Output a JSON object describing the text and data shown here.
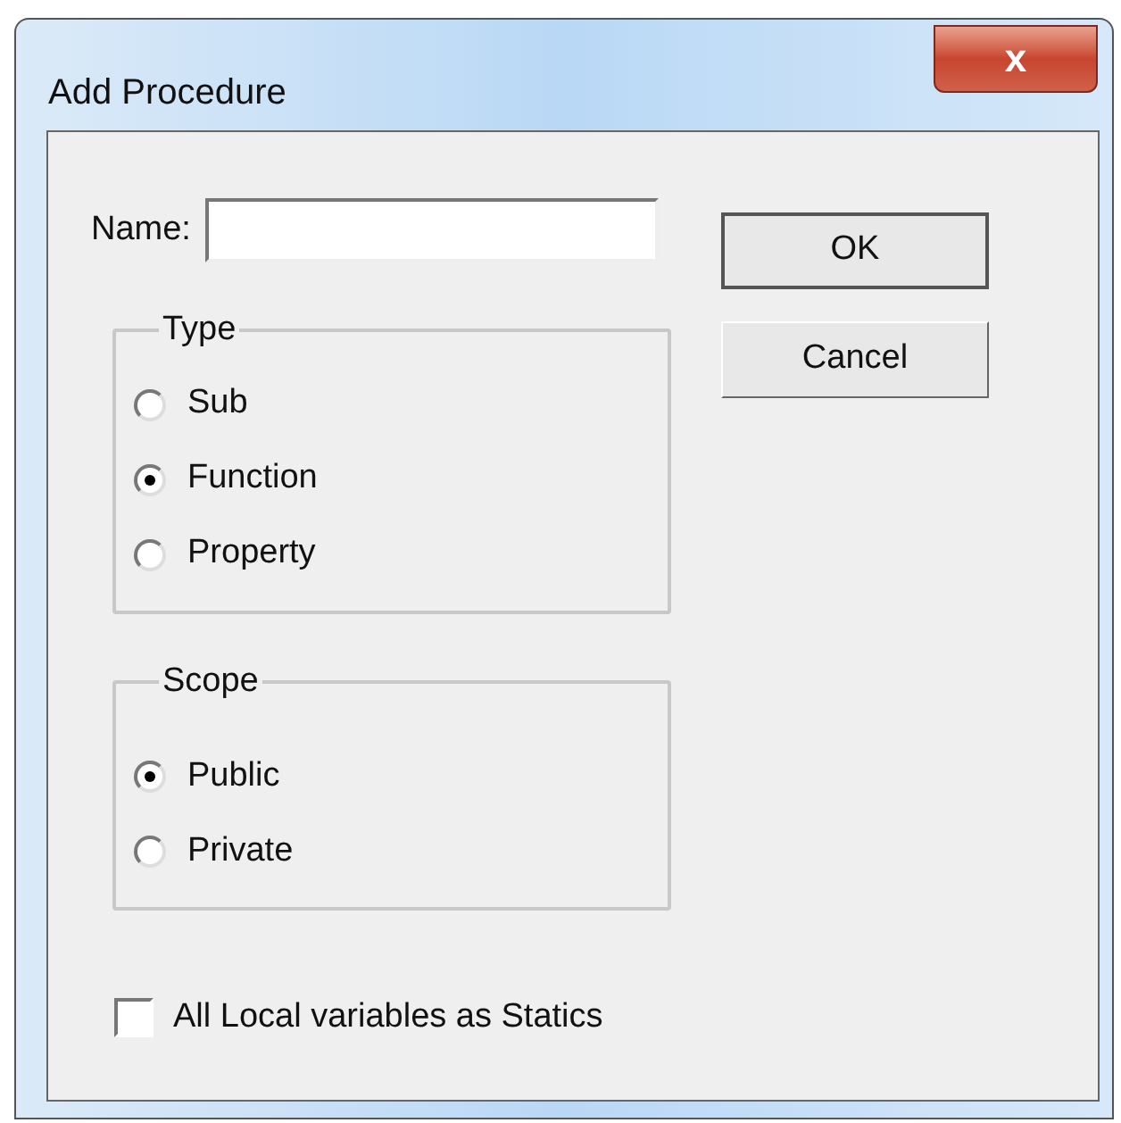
{
  "window": {
    "title": "Add Procedure",
    "close": "x"
  },
  "name_field": {
    "label": "Name:"
  },
  "buttons": [
    {
      "label": "OK",
      "default": true
    },
    {
      "label": "Cancel",
      "default": false
    }
  ],
  "groups": [
    {
      "title": "Type",
      "options": [
        {
          "label": "Sub",
          "selected": false
        },
        {
          "label": "Function",
          "selected": true
        },
        {
          "label": "Property",
          "selected": false
        }
      ]
    },
    {
      "title": "Scope",
      "options": [
        {
          "label": "Public",
          "selected": true
        },
        {
          "label": "Private",
          "selected": false
        }
      ]
    }
  ],
  "checkbox": {
    "label": "All Local variables as Statics",
    "checked": false
  }
}
